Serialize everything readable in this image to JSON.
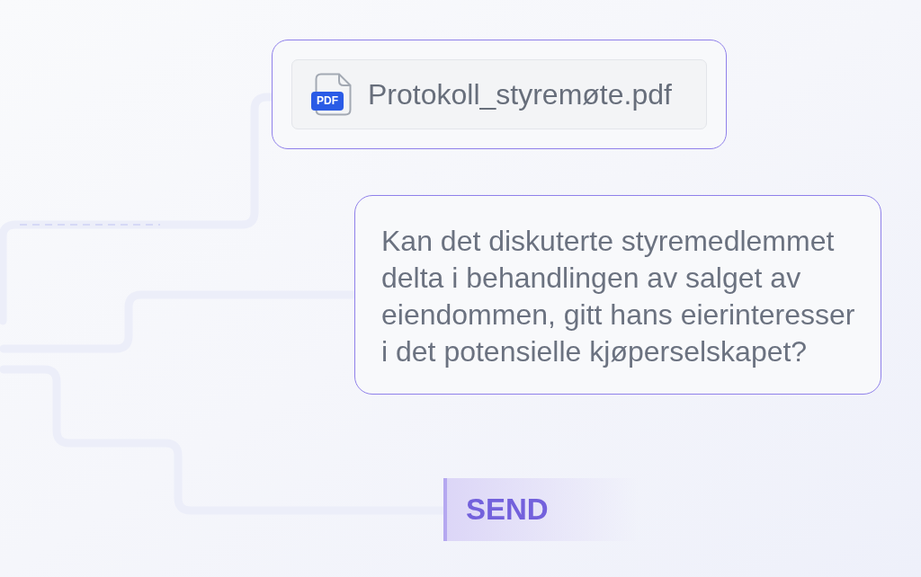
{
  "attachment": {
    "file_type": "PDF",
    "file_name": "Protokoll_styremøte.pdf"
  },
  "message": {
    "text": "Kan det diskuterte styremedlemmet delta i behandlingen av salget av eiendommen, gitt hans eierinteresser i det potensielle kjøperselskapet?"
  },
  "send_button": {
    "label": "SEND"
  }
}
